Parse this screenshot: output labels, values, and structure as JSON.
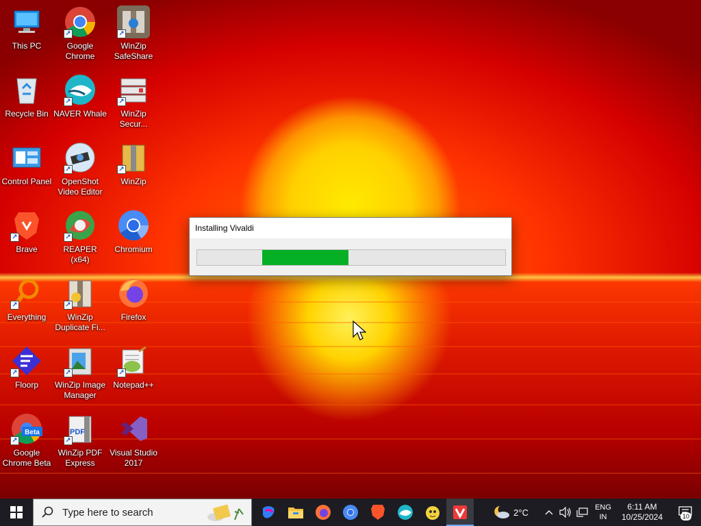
{
  "desktop": {
    "icons": [
      {
        "label": "This PC",
        "icon": "this-pc-icon"
      },
      {
        "label": "Google Chrome",
        "icon": "chrome-icon"
      },
      {
        "label": "WinZip SafeShare",
        "icon": "winzip-safeshare-icon"
      },
      {
        "label": "Recycle Bin",
        "icon": "recycle-bin-icon"
      },
      {
        "label": "NAVER Whale",
        "icon": "naver-whale-icon"
      },
      {
        "label": "WinZip Secur...",
        "icon": "winzip-secure-icon"
      },
      {
        "label": "Control Panel",
        "icon": "control-panel-icon"
      },
      {
        "label": "OpenShot Video Editor",
        "icon": "openshot-icon"
      },
      {
        "label": "WinZip",
        "icon": "winzip-icon"
      },
      {
        "label": "Brave",
        "icon": "brave-icon"
      },
      {
        "label": "REAPER (x64)",
        "icon": "reaper-icon"
      },
      {
        "label": "Chromium",
        "icon": "chromium-icon"
      },
      {
        "label": "Everything",
        "icon": "everything-icon"
      },
      {
        "label": "WinZip Duplicate Fi...",
        "icon": "winzip-duplicate-icon"
      },
      {
        "label": "Firefox",
        "icon": "firefox-icon"
      },
      {
        "label": "Floorp",
        "icon": "floorp-icon"
      },
      {
        "label": "WinZip Image Manager",
        "icon": "winzip-image-icon"
      },
      {
        "label": "Notepad++",
        "icon": "notepadpp-icon"
      },
      {
        "label": "Google Chrome Beta",
        "icon": "chrome-beta-icon",
        "badge": "Beta"
      },
      {
        "label": "WinZip PDF Express",
        "icon": "winzip-pdf-icon",
        "badge": "PDF"
      },
      {
        "label": "Visual Studio 2017",
        "icon": "visual-studio-icon"
      }
    ]
  },
  "dialog": {
    "title": "Installing Vivaldi",
    "progress_start": 0.21,
    "progress_end": 0.49,
    "accent": "#06b025"
  },
  "taskbar": {
    "search_placeholder": "Type here to search",
    "apps": [
      {
        "name": "copilot-icon",
        "running": false
      },
      {
        "name": "file-explorer-icon",
        "running": false
      },
      {
        "name": "firefox-icon",
        "running": false
      },
      {
        "name": "chromium-icon",
        "running": false
      },
      {
        "name": "brave-icon",
        "running": false
      },
      {
        "name": "naver-whale-icon",
        "running": false
      },
      {
        "name": "tor-like-icon",
        "running": false
      },
      {
        "name": "vivaldi-installer-icon",
        "running": true,
        "active": true
      }
    ],
    "weather": {
      "temp": "2°C",
      "icon": "partly-cloudy-night-icon"
    },
    "language": {
      "line1": "ENG",
      "line2": "IN"
    },
    "clock": {
      "time": "6:11 AM",
      "date": "10/25/2024"
    },
    "notifications": {
      "count": "10"
    }
  }
}
